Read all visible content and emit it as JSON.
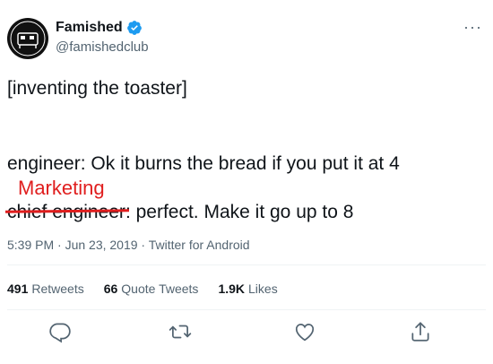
{
  "author": {
    "name": "Famished",
    "handle": "@famishedclub",
    "verified": true,
    "avatar_icon": "famished-club-logo"
  },
  "more_label": "···",
  "tweet": {
    "line1": "[inventing the toaster]",
    "line2": "engineer: Ok it burns the bread if you put it at 4",
    "line3_struck": "chief engineer",
    "line3_rest": ": perfect. Make it go up to 8",
    "overlay_text": "Marketing"
  },
  "meta": "5:39 PM · Jun 23, 2019 · Twitter for Android",
  "stats": [
    {
      "num": "491",
      "label": "Retweets"
    },
    {
      "num": "66",
      "label": "Quote Tweets"
    },
    {
      "num": "1.9K",
      "label": "Likes"
    }
  ],
  "actions": [
    "reply-icon",
    "retweet-icon",
    "like-icon",
    "share-icon"
  ],
  "colors": {
    "accent": "#1d9bf0",
    "secondary_text": "#536471",
    "annotation_red": "#e01e1e"
  }
}
